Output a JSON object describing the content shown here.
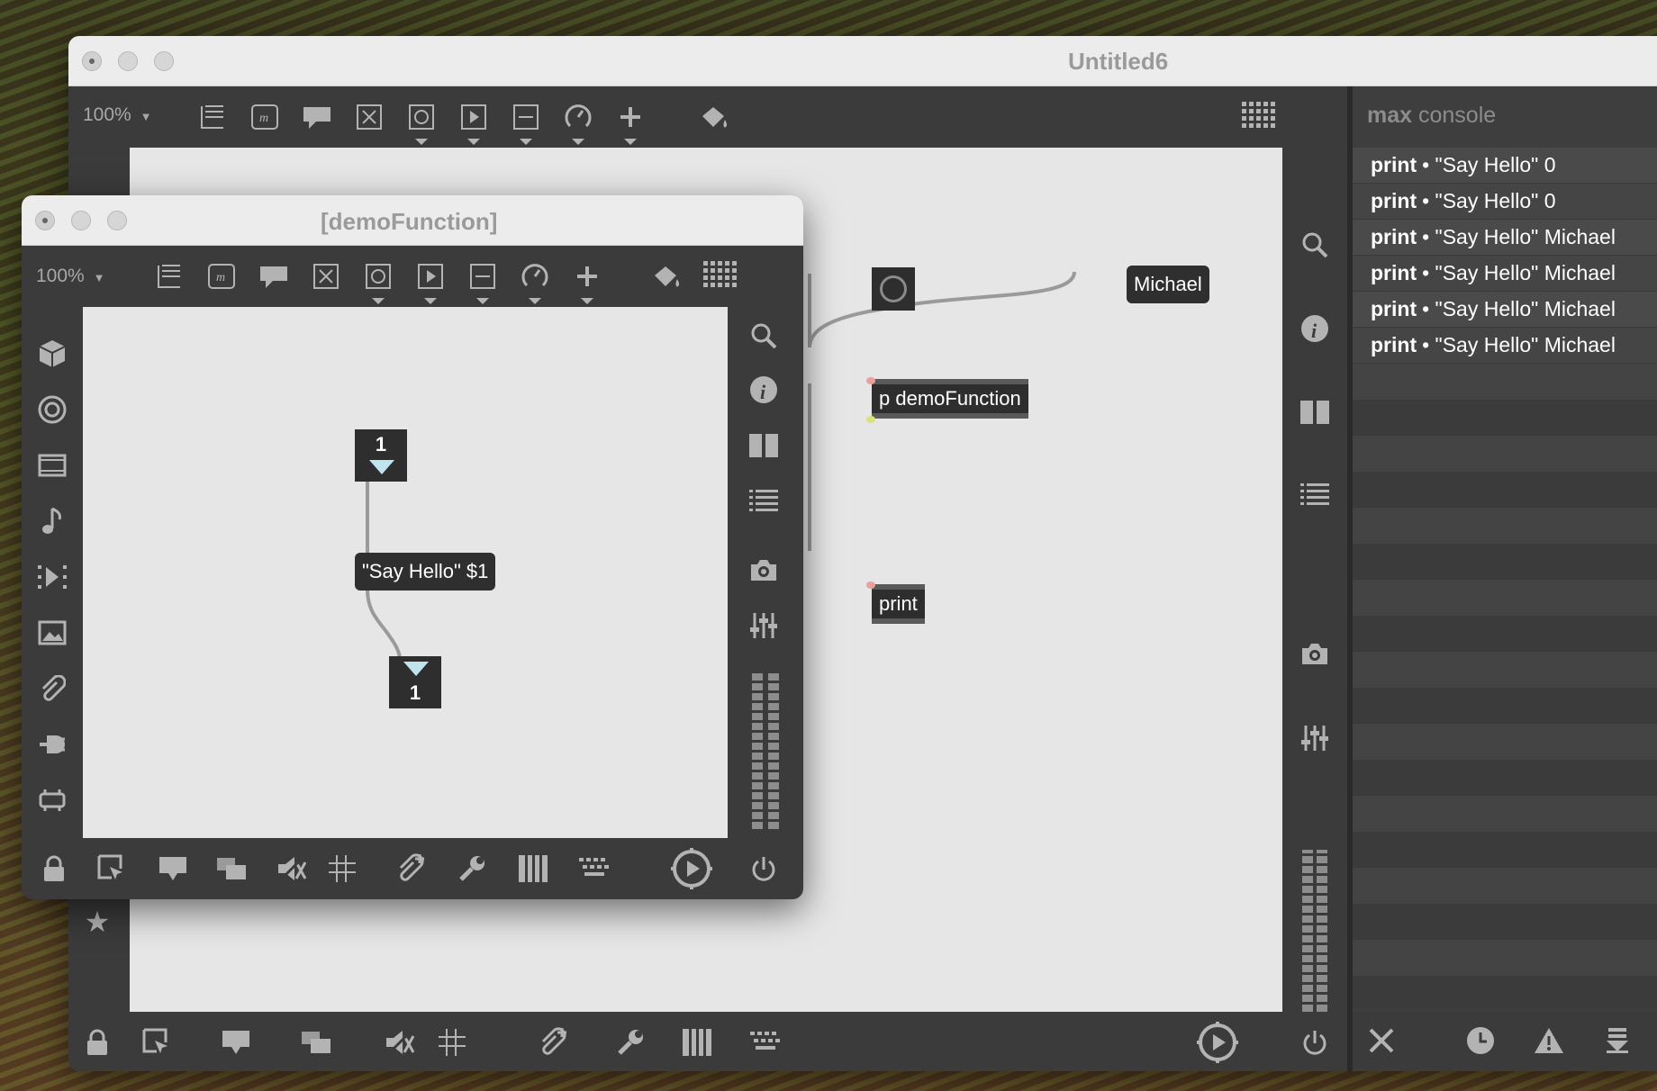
{
  "main_window": {
    "title": "Untitled6",
    "zoom": "100%",
    "toolbar_icons": [
      "object-icon",
      "message-icon",
      "comment-icon",
      "toggle-icon",
      "button-icon",
      "playbar-icon",
      "slider-icon",
      "dial-icon",
      "plus-icon",
      "paint-bucket-icon",
      "grid-icon"
    ],
    "patch": {
      "message_michael": "Michael",
      "object_demo": "p demoFunction",
      "object_print": "print"
    },
    "sidebar_right_icons": [
      "search-icon",
      "info-icon",
      "split-view-icon",
      "list-icon",
      "camera-icon",
      "mixer-icon"
    ],
    "bottom_icons": [
      "lock-icon",
      "presentation-select-icon",
      "comment-bubble-icon",
      "layers-icon",
      "mute-icon",
      "grid-snap-icon",
      "attach-icon",
      "wrench-icon",
      "piano-icon",
      "keyboard-icon",
      "audio-play-icon",
      "power-icon"
    ]
  },
  "console": {
    "title_bold": "max",
    "title_rest": "console",
    "entries": [
      {
        "source": "print",
        "message": "• \"Say Hello\" 0"
      },
      {
        "source": "print",
        "message": "• \"Say Hello\" 0"
      },
      {
        "source": "print",
        "message": "• \"Say Hello\" Michael"
      },
      {
        "source": "print",
        "message": "• \"Say Hello\" Michael"
      },
      {
        "source": "print",
        "message": "• \"Say Hello\" Michael"
      },
      {
        "source": "print",
        "message": "• \"Say Hello\" Michael"
      }
    ],
    "footer_icons": [
      "clear-icon",
      "clock-icon",
      "warning-icon",
      "scroll-down-icon"
    ]
  },
  "sub_window": {
    "title": "[demoFunction]",
    "zoom": "100%",
    "patch": {
      "inlet_number": "1",
      "message_say_hello": "\"Say Hello\" $1",
      "outlet_number": "1"
    },
    "left_sidebar_icons": [
      "cube-icon",
      "circle-target-icon",
      "film-icon",
      "music-note-icon",
      "sequence-icon",
      "image-icon",
      "paperclip-icon",
      "plug-icon",
      "hardware-icon"
    ]
  },
  "favorite_icon": "star-icon"
}
